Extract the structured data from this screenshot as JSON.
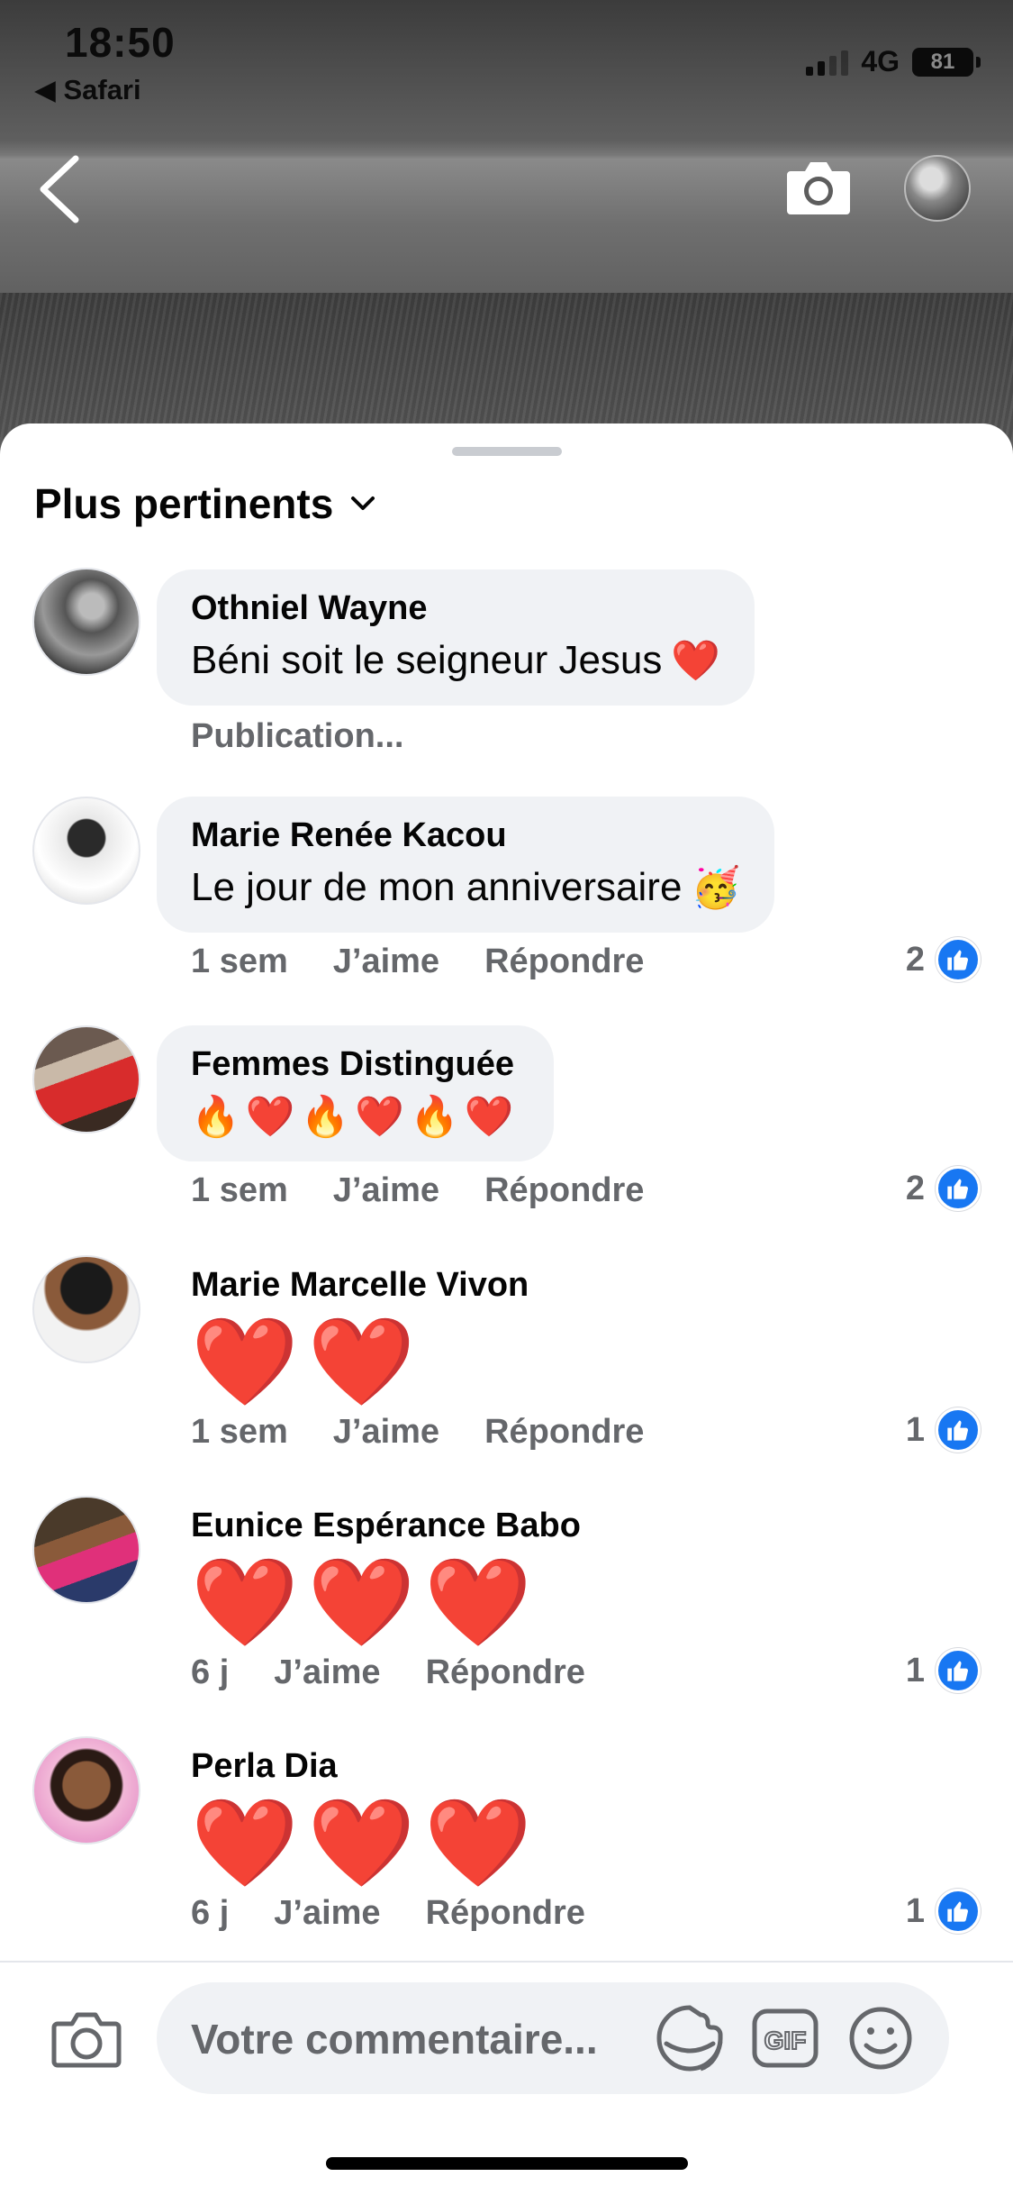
{
  "status_bar": {
    "time": "18:50",
    "back_app": "◀ Safari",
    "network": "4G",
    "battery": "81"
  },
  "header": {
    "back_icon": "chevron-left-icon",
    "camera_icon": "camera-icon"
  },
  "sort": {
    "label": "Plus pertinents"
  },
  "comments": [
    {
      "name": "Othniel Wayne",
      "text": "Béni soit le seigneur Jesus",
      "emoji": "❤️",
      "status": "Publication..."
    },
    {
      "name": "Marie Renée Kacou",
      "text": "Le jour de mon anniversaire",
      "emoji": "🥳",
      "time": "1 sem",
      "like": "J’aime",
      "reply": "Répondre",
      "reactions": "2"
    },
    {
      "name": "Femmes Distinguée",
      "emoji_text": "🔥❤️🔥❤️🔥❤️",
      "time": "1 sem",
      "like": "J’aime",
      "reply": "Répondre",
      "reactions": "2"
    },
    {
      "name": "Marie Marcelle Vivon",
      "emoji_text": "❤️❤️",
      "time": "1 sem",
      "like": "J’aime",
      "reply": "Répondre",
      "reactions": "1"
    },
    {
      "name": "Eunice Espérance Babo",
      "emoji_text": "❤️❤️❤️",
      "time": "6 j",
      "like": "J’aime",
      "reply": "Répondre",
      "reactions": "1"
    },
    {
      "name": "Perla Dia",
      "emoji_text": "❤️❤️❤️",
      "time": "6 j",
      "like": "J’aime",
      "reply": "Répondre",
      "reactions": "1"
    }
  ],
  "composer": {
    "placeholder": "Votre commentaire...",
    "gif_label": "GIF"
  },
  "colors": {
    "accent": "#1877f2",
    "bubble": "#f0f2f5",
    "secondary_text": "#65676b",
    "heart": "#e0242f"
  }
}
